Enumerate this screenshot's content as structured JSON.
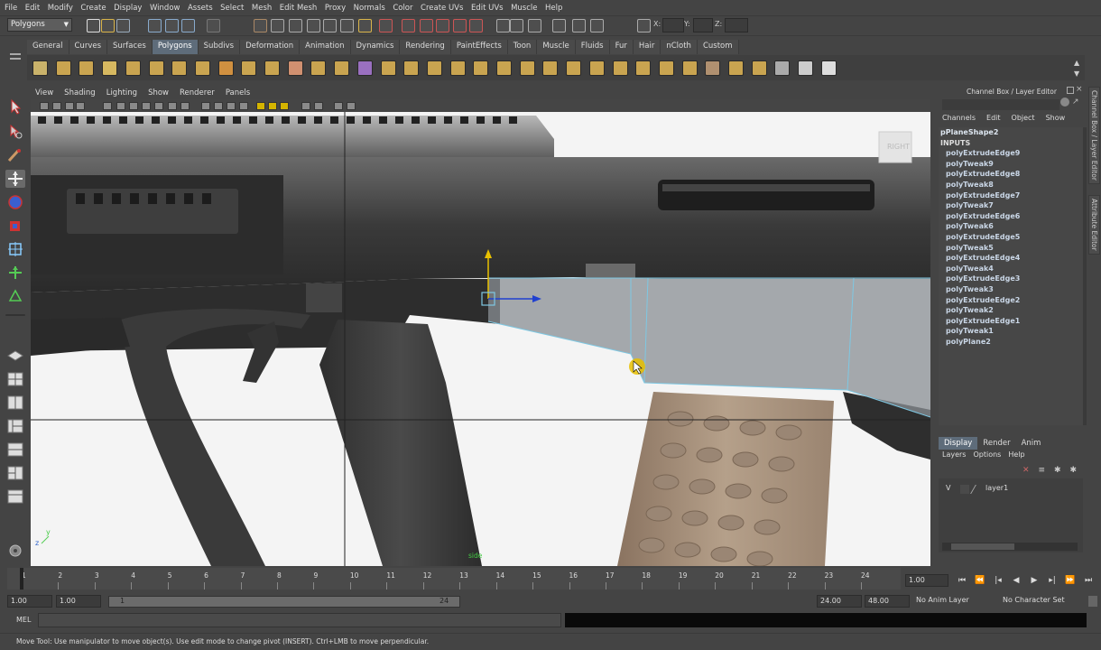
{
  "menubar": [
    "File",
    "Edit",
    "Modify",
    "Create",
    "Display",
    "Window",
    "Assets",
    "Select",
    "Mesh",
    "Edit Mesh",
    "Proxy",
    "Normals",
    "Color",
    "Create UVs",
    "Edit UVs",
    "Muscle",
    "Help"
  ],
  "status": {
    "mode": "Polygons",
    "x_label": "X:",
    "y_label": "Y:",
    "z_label": "Z:"
  },
  "shelf_tabs": [
    "General",
    "Curves",
    "Surfaces",
    "Polygons",
    "Subdivs",
    "Deformation",
    "Animation",
    "Dynamics",
    "Rendering",
    "PaintEffects",
    "Toon",
    "Muscle",
    "Fluids",
    "Fur",
    "Hair",
    "nCloth",
    "Custom"
  ],
  "shelf_active": "Polygons",
  "panel_menu": [
    "View",
    "Shading",
    "Lighting",
    "Show",
    "Renderer",
    "Panels"
  ],
  "viewport": {
    "cube_label": "RIGHT",
    "camera_label": "side",
    "axis_z": "z",
    "axis_y": "y"
  },
  "channel_box": {
    "title": "Channel Box / Layer Editor",
    "menu": [
      "Channels",
      "Edit",
      "Object",
      "Show"
    ],
    "object": "pPlaneShape2",
    "inputs_label": "INPUTS",
    "history": [
      "polyExtrudeEdge9",
      "polyTweak9",
      "polyExtrudeEdge8",
      "polyTweak8",
      "polyExtrudeEdge7",
      "polyTweak7",
      "polyExtrudeEdge6",
      "polyTweak6",
      "polyExtrudeEdge5",
      "polyTweak5",
      "polyExtrudeEdge4",
      "polyTweak4",
      "polyExtrudeEdge3",
      "polyTweak3",
      "polyExtrudeEdge2",
      "polyTweak2",
      "polyExtrudeEdge1",
      "polyTweak1",
      "polyPlane2"
    ]
  },
  "side_tabs": [
    "Channel Box / Layer Editor",
    "Attribute Editor"
  ],
  "layer_editor": {
    "tabs": [
      "Display",
      "Render",
      "Anim"
    ],
    "menu": [
      "Layers",
      "Options",
      "Help"
    ],
    "layer_visibility": "V",
    "layer_name": "layer1"
  },
  "timeline": {
    "ticks": [
      "1",
      "2",
      "3",
      "4",
      "5",
      "6",
      "7",
      "8",
      "9",
      "10",
      "11",
      "12",
      "13",
      "14",
      "15",
      "16",
      "17",
      "18",
      "19",
      "20",
      "21",
      "22",
      "23",
      "24"
    ],
    "current_frame": "1.00"
  },
  "range": {
    "start": "1.00",
    "playback_start": "1.00",
    "slider_start": "1",
    "slider_end": "24",
    "playback_end": "24.00",
    "end": "48.00",
    "anim_layer": "No Anim Layer",
    "character_set": "No Character Set"
  },
  "mel_label": "MEL",
  "help_line": "Move Tool: Use manipulator to move object(s). Use edit mode to change pivot (INSERT).  Ctrl+LMB to move perpendicular.",
  "colors": {
    "accent": "#5e6c7a",
    "mesh_wire": "#7ec8e3",
    "manip_y": "#e8c000",
    "manip_x": "#2040d0"
  }
}
